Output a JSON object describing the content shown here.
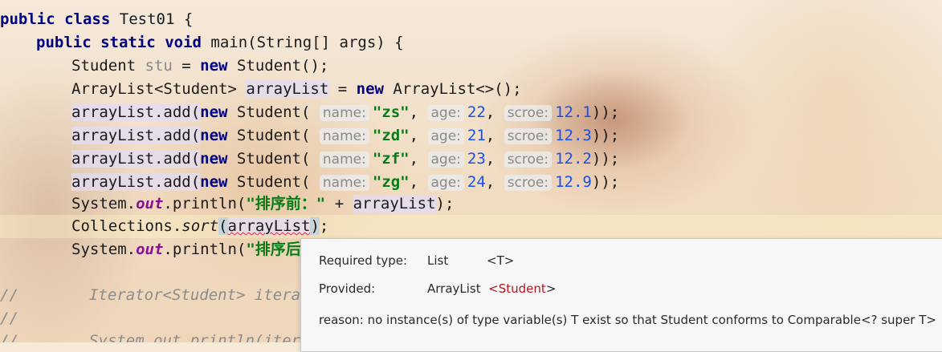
{
  "code": {
    "l1": {
      "kw1": "public",
      "kw2": "class",
      "name": "Test01 {"
    },
    "l2": {
      "kw1": "public",
      "kw2": "static",
      "kw3": "void",
      "rest": "main(String[] args) {"
    },
    "l3": {
      "type": "Student ",
      "var": "stu",
      "eq": " = ",
      "kw": "new",
      "rest": " Student();"
    },
    "l4": {
      "type": "ArrayList<Student> ",
      "var": "arrayList",
      "eq": " = ",
      "kw": "new",
      "rest": " ArrayList<>();"
    },
    "adds": [
      {
        "name": "\"zs\"",
        "age": "22",
        "scroe": "12.1"
      },
      {
        "name": "\"zd\"",
        "age": "21",
        "scroe": "12.3"
      },
      {
        "name": "\"zf\"",
        "age": "23",
        "scroe": "12.2"
      },
      {
        "name": "\"zg\"",
        "age": "24",
        "scroe": "12.9"
      }
    ],
    "hint_name": "name:",
    "hint_age": "age:",
    "hint_scroe": "scroe:",
    "add_prefix": "arrayList.add(",
    "new_kw": "new",
    "student_ctor": " Student(",
    "add_suffix": "));",
    "l9": {
      "a": "System.",
      "b": "out",
      "c": ".println(",
      "str": "\"排序前：\"",
      "d": " + ",
      "e": "arrayList",
      "f": ");"
    },
    "l10": {
      "a": "Collections.",
      "b": "sort",
      "c": "(",
      "d": "arrayList",
      "e": ")",
      "f": ";"
    },
    "l11": {
      "a": "System.",
      "b": "out",
      "c": ".println(",
      "str": "\"排序后"
    },
    "c1": {
      "slash": "//",
      "text": "Iterator<Student> iterat"
    },
    "c2": {
      "slash": "//"
    },
    "c3": {
      "slash": "//",
      "text": "System.out.println(itera"
    }
  },
  "tooltip": {
    "required_label": "Required type:",
    "required_value": "List",
    "required_param": "<T>",
    "provided_label": "Provided:",
    "provided_value": "ArrayList",
    "provided_lt": "<",
    "provided_param": "Student",
    "provided_gt": ">",
    "reason": "reason: no instance(s) of type variable(s) T exist so that Student conforms to Comparable<? super T>"
  }
}
